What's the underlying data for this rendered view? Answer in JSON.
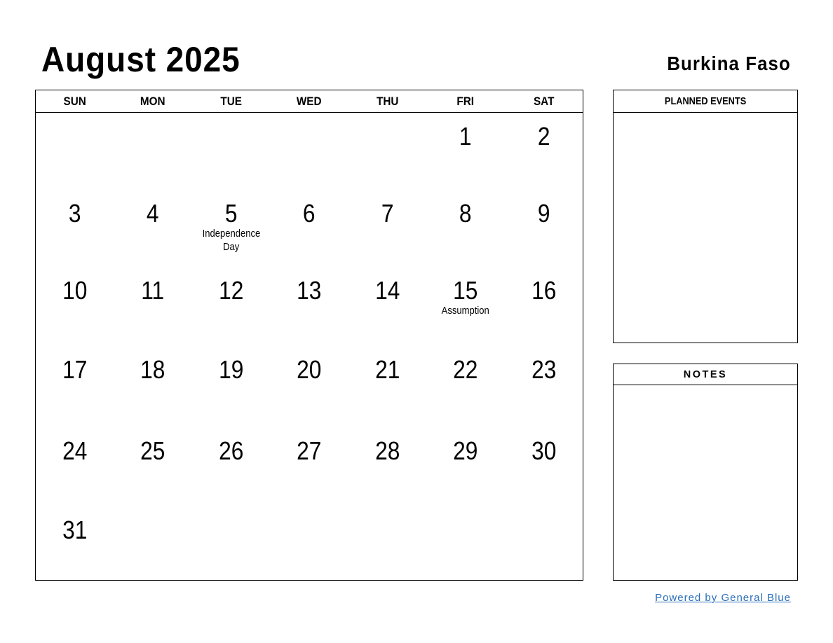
{
  "header": {
    "title": "August 2025",
    "country": "Burkina Faso"
  },
  "calendar": {
    "weekdays": [
      "SUN",
      "MON",
      "TUE",
      "WED",
      "THU",
      "FRI",
      "SAT"
    ],
    "weeks": [
      [
        {
          "day": ""
        },
        {
          "day": ""
        },
        {
          "day": ""
        },
        {
          "day": ""
        },
        {
          "day": ""
        },
        {
          "day": "1"
        },
        {
          "day": "2"
        }
      ],
      [
        {
          "day": "3"
        },
        {
          "day": "4"
        },
        {
          "day": "5",
          "holiday": "Independence Day"
        },
        {
          "day": "6"
        },
        {
          "day": "7"
        },
        {
          "day": "8"
        },
        {
          "day": "9"
        }
      ],
      [
        {
          "day": "10"
        },
        {
          "day": "11"
        },
        {
          "day": "12"
        },
        {
          "day": "13"
        },
        {
          "day": "14"
        },
        {
          "day": "15",
          "holiday": "Assumption"
        },
        {
          "day": "16"
        }
      ],
      [
        {
          "day": "17"
        },
        {
          "day": "18"
        },
        {
          "day": "19"
        },
        {
          "day": "20"
        },
        {
          "day": "21"
        },
        {
          "day": "22"
        },
        {
          "day": "23"
        }
      ],
      [
        {
          "day": "24"
        },
        {
          "day": "25"
        },
        {
          "day": "26"
        },
        {
          "day": "27"
        },
        {
          "day": "28"
        },
        {
          "day": "29"
        },
        {
          "day": "30"
        }
      ],
      [
        {
          "day": "31"
        },
        {
          "day": ""
        },
        {
          "day": ""
        },
        {
          "day": ""
        },
        {
          "day": ""
        },
        {
          "day": ""
        },
        {
          "day": ""
        }
      ]
    ]
  },
  "panels": {
    "planned_events_label": "PLANNED EVENTS",
    "notes_label": "NOTES"
  },
  "footer": {
    "link_text": "Powered by General Blue",
    "link_color": "#2a6ebb"
  }
}
